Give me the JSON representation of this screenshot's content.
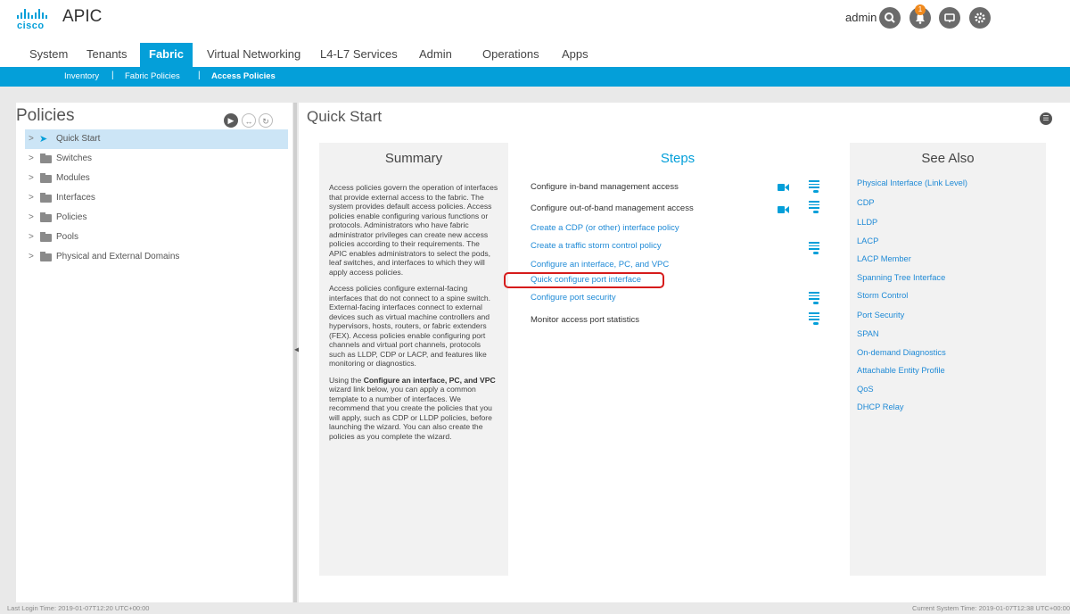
{
  "header": {
    "logo_text": "cisco",
    "app_title": "APIC",
    "user": "admin",
    "notification_count": "1",
    "icons": [
      "search-icon",
      "bell-icon",
      "feedback-icon",
      "gear-icon"
    ]
  },
  "nav": {
    "tabs": [
      "System",
      "Tenants",
      "Fabric",
      "Virtual Networking",
      "L4-L7 Services",
      "Admin",
      "Operations",
      "Apps"
    ],
    "active_tab": "Fabric",
    "subtabs": [
      "Inventory",
      "Fabric Policies",
      "Access Policies"
    ],
    "separator": "|",
    "active_subtab": "Access Policies"
  },
  "left_panel": {
    "title": "Policies",
    "tree": [
      {
        "label": "Quick Start",
        "selected": true,
        "icon": "quick-start-icon"
      },
      {
        "label": "Switches",
        "icon": "folder-icon"
      },
      {
        "label": "Modules",
        "icon": "folder-icon"
      },
      {
        "label": "Interfaces",
        "icon": "folder-icon"
      },
      {
        "label": "Policies",
        "icon": "folder-icon"
      },
      {
        "label": "Pools",
        "icon": "folder-icon"
      },
      {
        "label": "Physical and External Domains",
        "icon": "folder-icon"
      }
    ]
  },
  "quick_start": {
    "title": "Quick Start",
    "summary": {
      "title": "Summary",
      "p1": "Access policies govern the operation of interfaces that provide external access to the fabric. The system provides default access policies. Access policies enable configuring various functions or protocols. Administrators who have fabric administrator privileges can create new access policies according to their requirements. The APIC enables administrators to select the pods, leaf switches, and interfaces to which they will apply access policies.",
      "p2": "Access policies configure external-facing interfaces that do not connect to a spine switch. External-facing interfaces connect to external devices such as virtual machine controllers and hypervisors, hosts, routers, or fabric extenders (FEX). Access policies enable configuring port channels and virtual port channels, protocols such as LLDP, CDP or LACP, and features like monitoring or diagnostics.",
      "p3_pre": "Using the ",
      "p3_bold": "Configure an interface, PC, and VPC",
      "p3_post": " wizard link below, you can apply a common template to a number of interfaces. We recommend that you create the policies that you will apply, such as CDP or LLDP policies, before launching the wizard. You can also create the policies as you complete the wizard."
    },
    "steps": {
      "title": "Steps",
      "items": [
        "Configure in-band management access",
        "Configure out-of-band management access",
        "Create a CDP (or other) interface policy",
        "Create a traffic storm control policy",
        "Configure an interface, PC, and VPC",
        "Quick configure port interface",
        "Configure port security",
        "Monitor access port statistics"
      ]
    },
    "see_also": {
      "title": "See Also",
      "links": [
        "Physical Interface (Link Level)",
        "CDP",
        "LLDP",
        "LACP",
        "LACP Member",
        "Spanning Tree Interface",
        "Storm Control",
        "Port Security",
        "SPAN",
        "On-demand Diagnostics",
        "Attachable Entity Profile",
        "QoS",
        "DHCP Relay"
      ]
    }
  },
  "footer": {
    "last_login": "Last Login Time: 2019-01-07T12:20 UTC+00:00",
    "system_time": "Current System Time: 2019-01-07T12:38 UTC+00:00"
  },
  "colors": {
    "accent": "#049fd9",
    "link": "#1f8ad6",
    "highlight_border": "#d61b1b"
  }
}
